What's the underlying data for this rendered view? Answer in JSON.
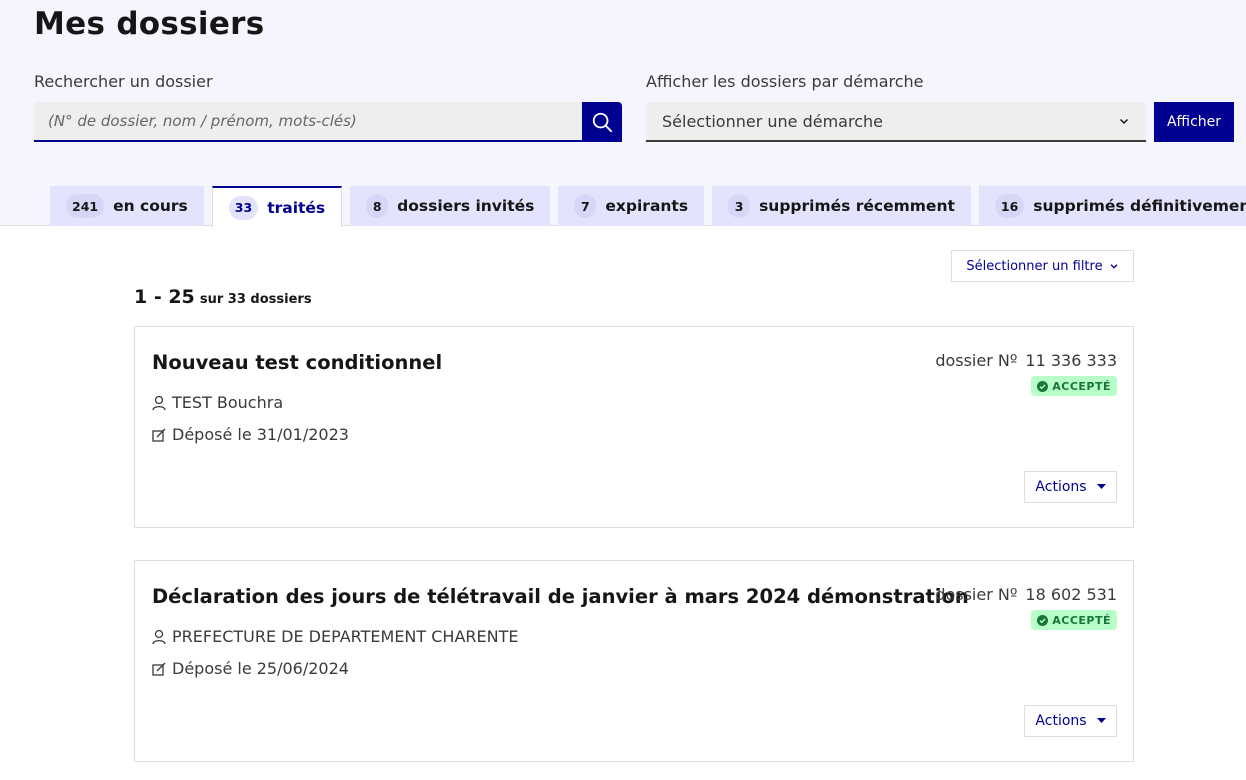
{
  "page": {
    "title": "Mes dossiers"
  },
  "search": {
    "label": "Rechercher un dossier",
    "placeholder": "(N° de dossier, nom / prénom, mots-clés)",
    "button_icon": "search-icon"
  },
  "procedure_filter": {
    "label": "Afficher les dossiers par démarche",
    "selected": "Sélectionner une démarche",
    "button_label": "Afficher"
  },
  "tabs": [
    {
      "count": "241",
      "label": "en cours",
      "active": false
    },
    {
      "count": "33",
      "label": "traités",
      "active": true
    },
    {
      "count": "8",
      "label": "dossiers invités",
      "active": false
    },
    {
      "count": "7",
      "label": "expirants",
      "active": false
    },
    {
      "count": "3",
      "label": "supprimés récemment",
      "active": false
    },
    {
      "count": "16",
      "label": "supprimés définitivement",
      "active": false
    }
  ],
  "filter": {
    "label": "Sélectionner un filtre"
  },
  "pagination": {
    "range": "1 - 25",
    "total": "sur 33 dossiers"
  },
  "dossiers": [
    {
      "title": "Nouveau test conditionnel",
      "owner": "TEST Bouchra",
      "deposited": "Déposé le 31/01/2023",
      "number_label": "dossier Nº",
      "number": "11 336 333",
      "status": "ACCEPTÉ",
      "actions_label": "Actions"
    },
    {
      "title": "Déclaration des jours de télétravail de janvier à mars 2024 démonstration",
      "owner": "PREFECTURE DE DEPARTEMENT CHARENTE",
      "deposited": "Déposé le 25/06/2024",
      "number_label": "dossier Nº",
      "number": "18 602 531",
      "status": "ACCEPTÉ",
      "actions_label": "Actions"
    }
  ],
  "colors": {
    "primary": "#000091",
    "header_bg": "#f5f5fe",
    "tab_bg": "#e3e3fd",
    "badge_bg": "#b8fec9",
    "badge_text": "#18753c"
  }
}
